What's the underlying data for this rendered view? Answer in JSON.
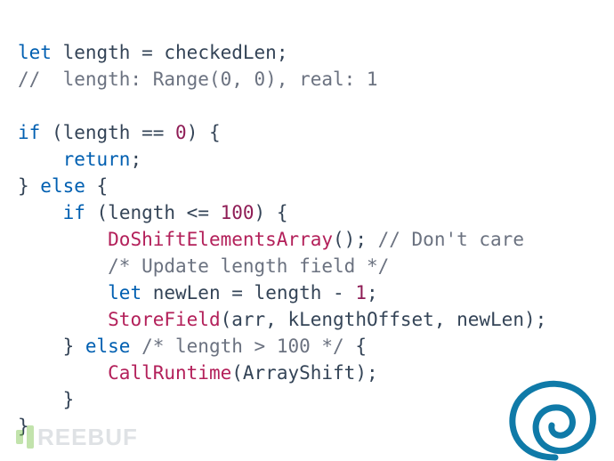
{
  "code": {
    "line1": {
      "kw": "let",
      "id": "length",
      "eq": " = ",
      "rhs": "checkedLen",
      "semi": ";"
    },
    "line2": {
      "comment": "//  length: Range(0, 0), real: 1"
    },
    "line3": {
      "blank": ""
    },
    "line4": {
      "kw": "if",
      "open": " (",
      "lhs": "length",
      "op": " == ",
      "num": "0",
      "close": ") {"
    },
    "line5": {
      "indent": "    ",
      "kw": "return",
      "semi": ";"
    },
    "line6": {
      "close": "} ",
      "kw": "else",
      "open": " {"
    },
    "line7": {
      "indent": "    ",
      "kw": "if",
      "open": " (",
      "lhs": "length",
      "op": " <= ",
      "num": "100",
      "close": ") {"
    },
    "line8": {
      "indent": "        ",
      "func": "DoShiftElementsArray",
      "args": "(); ",
      "comment": "// Don't care"
    },
    "line9": {
      "indent": "        ",
      "comment": "/* Update length field */"
    },
    "line10": {
      "indent": "        ",
      "kw": "let",
      "id": " newLen",
      "eq": " = ",
      "rhs": "length",
      "op": " - ",
      "num": "1",
      "semi": ";"
    },
    "line11": {
      "indent": "        ",
      "func": "StoreField",
      "open": "(",
      "args": "arr, kLengthOffset, newLen",
      "close": ");"
    },
    "line12": {
      "indent": "    ",
      "close1": "} ",
      "kw": "else",
      "comment": " /* length > 100 */ ",
      "open": "{"
    },
    "line13": {
      "indent": "        ",
      "func": "CallRuntime",
      "open": "(",
      "args": "ArrayShift",
      "close": ");"
    },
    "line14": {
      "indent": "    ",
      "close": "}"
    },
    "line15": {
      "close": "}"
    }
  },
  "watermark": {
    "text": "REEBUF"
  },
  "colors": {
    "keyword": "#005fb1",
    "identifier": "#344457",
    "number": "#8f1d56",
    "function": "#b3205a",
    "comment": "#6b7280",
    "swirl": "#0f7aa8"
  }
}
